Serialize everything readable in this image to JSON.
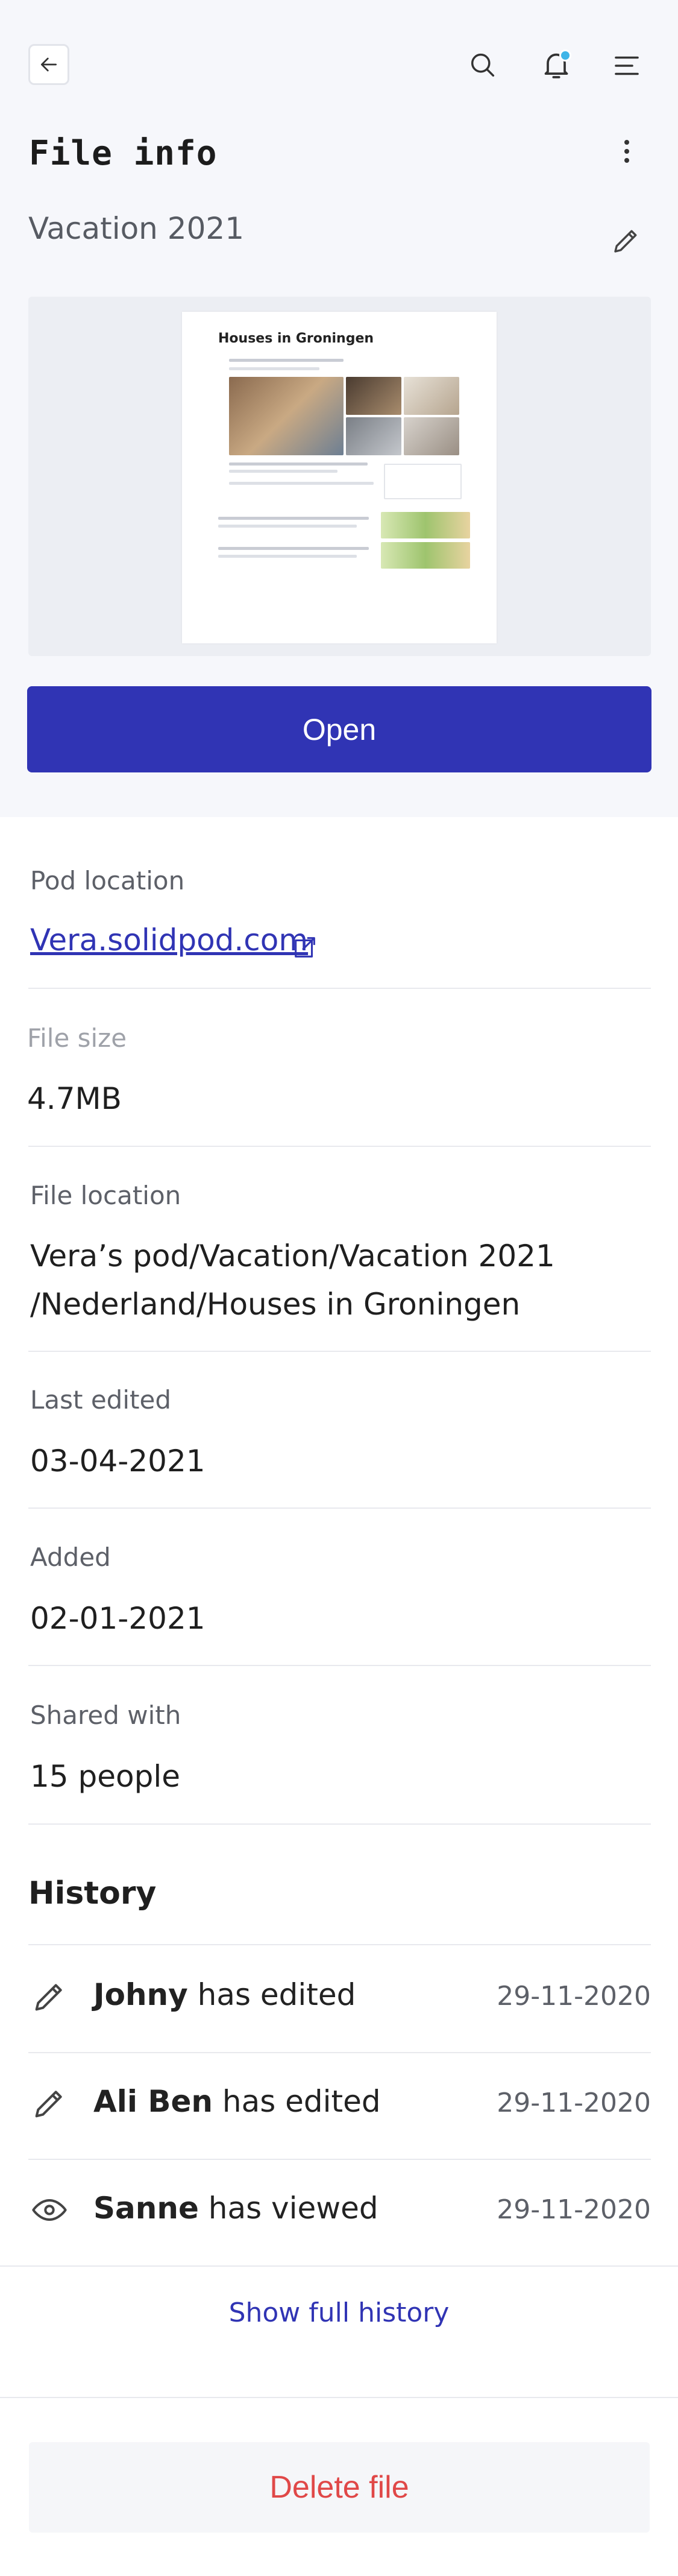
{
  "header": {
    "back_icon": "arrow-left-icon",
    "search_icon": "search-icon",
    "notifications_icon": "bell-icon",
    "notification_dot_color": "#3fb5e8",
    "menu_icon": "menu-icon"
  },
  "page": {
    "title": "File info",
    "more_icon": "more-vertical-icon"
  },
  "file": {
    "folder_name": "Vacation 2021",
    "edit_icon": "pencil-icon",
    "preview": {
      "doc_title": "Houses in Groningen"
    },
    "open_label": "Open"
  },
  "details": {
    "pod_location": {
      "label": "Pod location",
      "value": "Vera.solidpod.com",
      "icon": "external-link-icon"
    },
    "file_size": {
      "label": "File size",
      "value": "4.7MB"
    },
    "file_location": {
      "label": "File location",
      "line1": "Vera’s pod/Vacation/Vacation 2021",
      "line2": "/Nederland/Houses in Groningen"
    },
    "last_edited": {
      "label": "Last edited",
      "value": "03-04-2021"
    },
    "added": {
      "label": "Added",
      "value": "02-01-2021"
    },
    "shared_with": {
      "label": "Shared with",
      "value": "15 people"
    }
  },
  "history": {
    "title": "History",
    "items": [
      {
        "icon": "pencil-icon",
        "name": "Johny",
        "action": " has edited",
        "date": "29-11-2020"
      },
      {
        "icon": "pencil-icon",
        "name": "Ali Ben",
        "action": " has edited",
        "date": "29-11-2020"
      },
      {
        "icon": "eye-icon",
        "name": "Sanne",
        "action": " has viewed",
        "date": "29-11-2020"
      }
    ],
    "show_full_label": "Show full history"
  },
  "actions": {
    "delete_label": "Delete file"
  },
  "colors": {
    "primary": "#3034b4",
    "danger": "#e04848",
    "accent_dot": "#3fb5e8"
  }
}
